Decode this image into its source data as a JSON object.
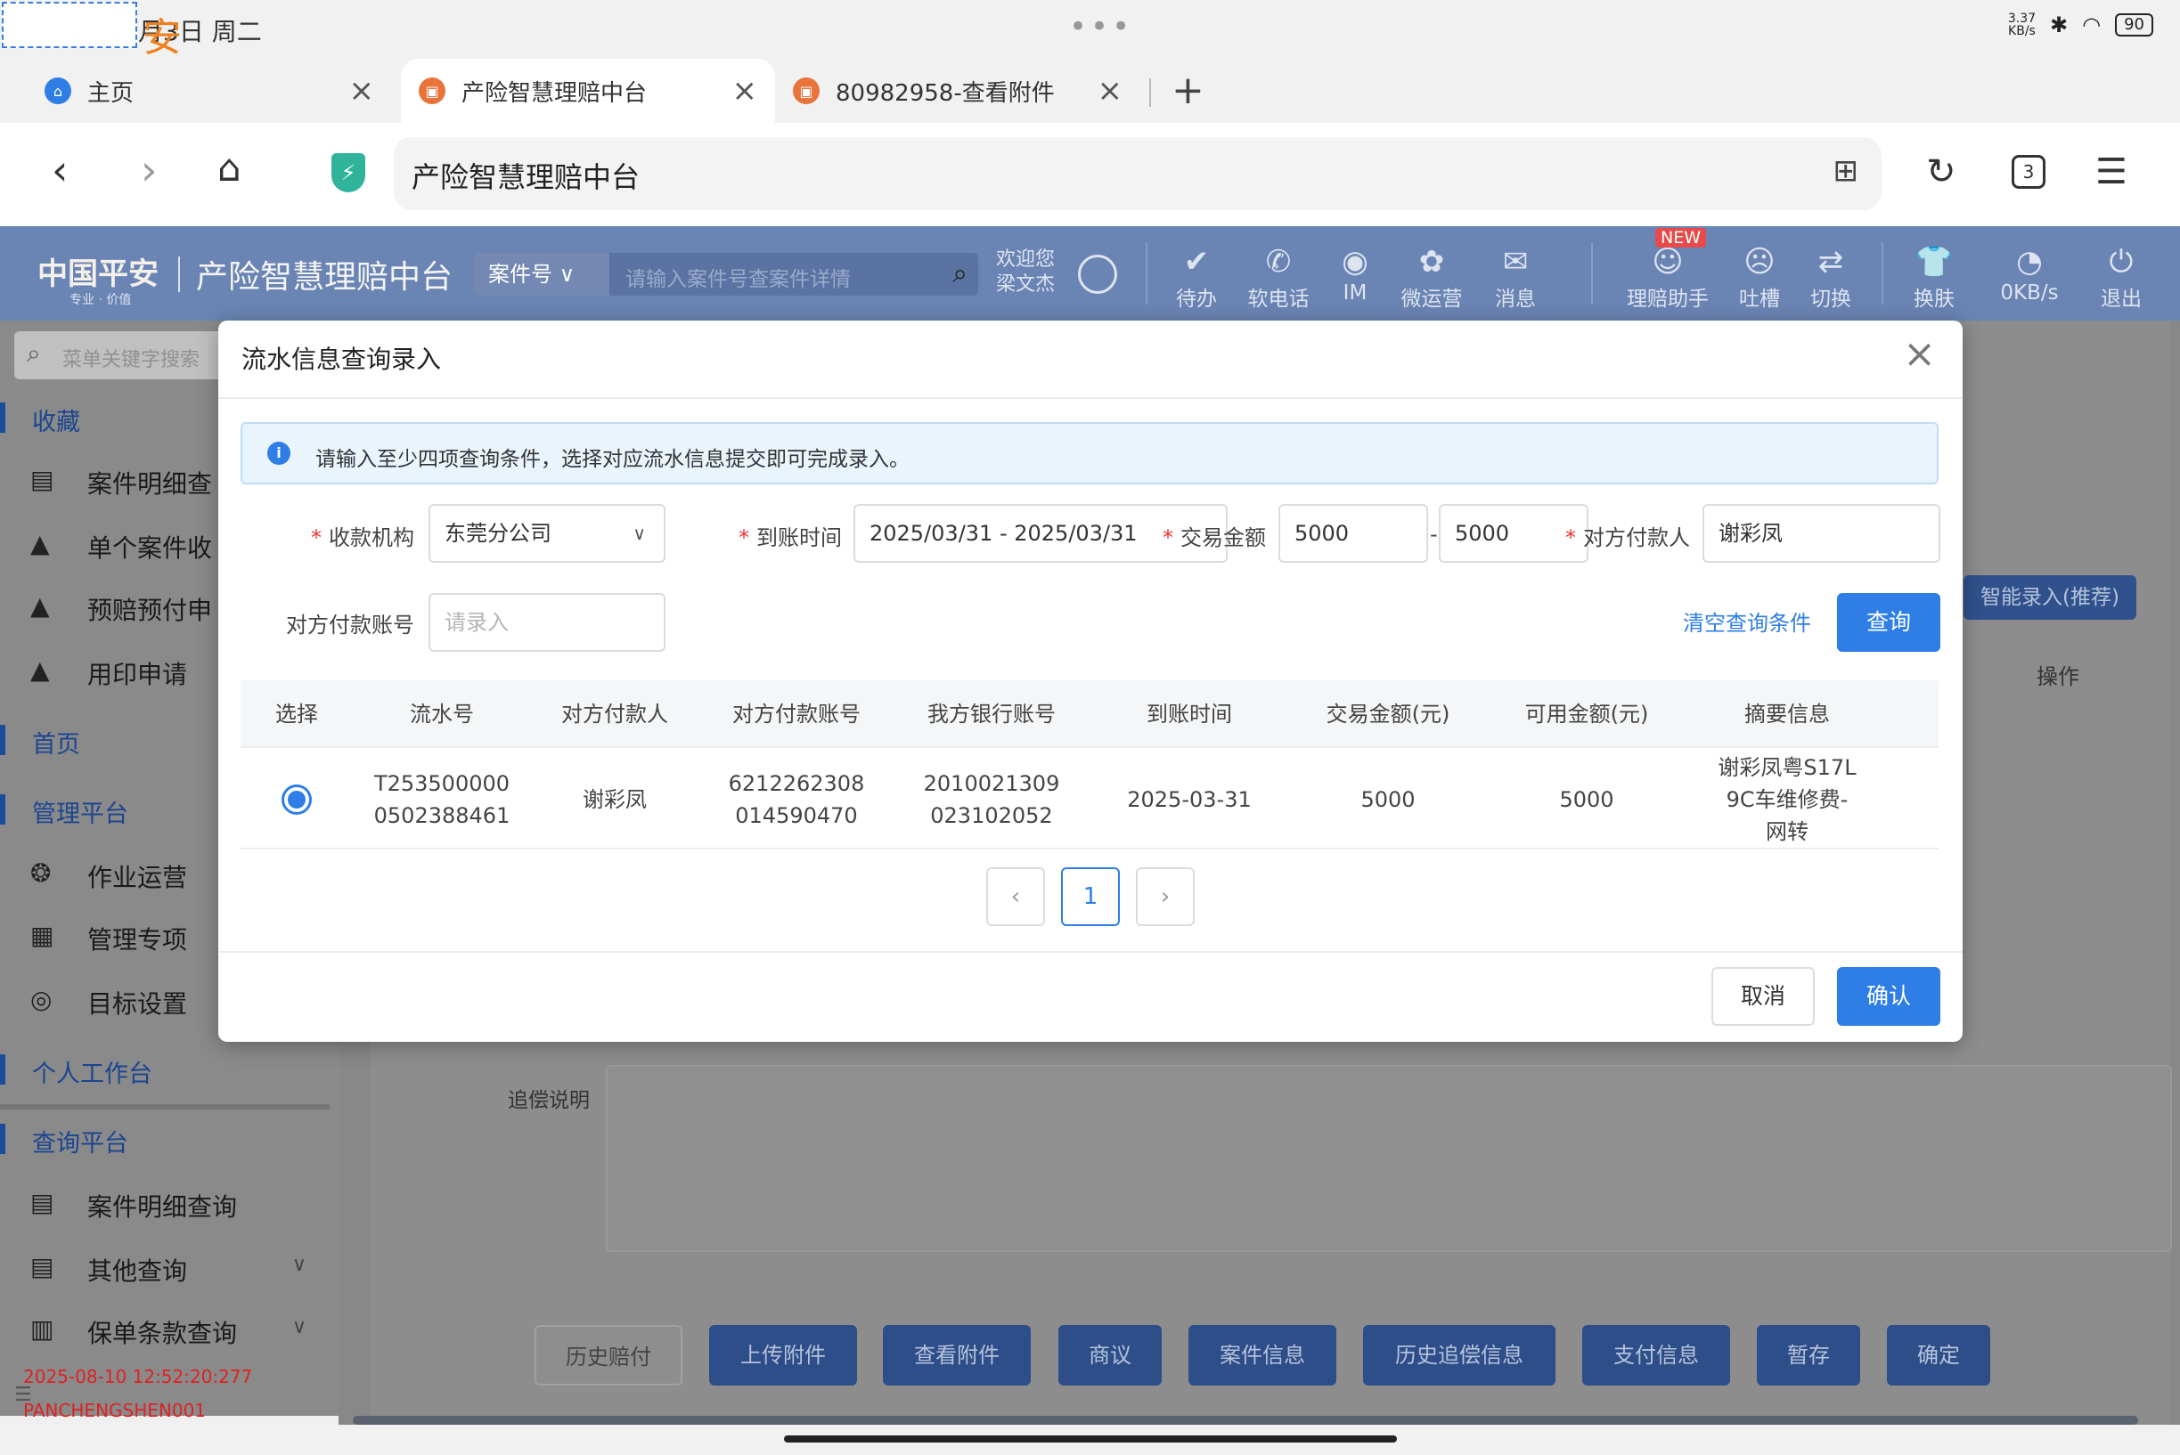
{
  "statusbar": {
    "orange_char": "安",
    "date": "月3日 周二",
    "dots": "•••",
    "speed_top": "3.37",
    "speed_unit": "KB/s",
    "battery": "90"
  },
  "browser": {
    "tabs": [
      {
        "label": "主页"
      },
      {
        "label": "产险智慧理赔中台"
      },
      {
        "label": "80982958-查看附件"
      }
    ],
    "url": "产险智慧理赔中台",
    "tab_count": "3"
  },
  "app_header": {
    "logo": "中国平安",
    "logo_sub": "专业 · 价值",
    "title": "产险智慧理赔中台",
    "search_type": "案件号",
    "search_placeholder": "请输入案件号查案件详情",
    "welcome_1": "欢迎您",
    "welcome_2": "梁文杰",
    "items": [
      {
        "label": "待办",
        "icon": "✔"
      },
      {
        "label": "软电话",
        "icon": "✆"
      },
      {
        "label": "IM",
        "icon": "◉"
      },
      {
        "label": "微运营",
        "icon": "✿"
      },
      {
        "label": "消息",
        "icon": "✉"
      },
      {
        "label": "理赔助手",
        "icon": "☺"
      },
      {
        "label": "吐槽",
        "icon": "☹"
      },
      {
        "label": "切换",
        "icon": "⇄"
      },
      {
        "label": "换肤",
        "icon": "👕"
      },
      {
        "label": "0KB/s",
        "icon": "◔"
      },
      {
        "label": "退出",
        "icon": "⏻"
      }
    ],
    "new_badge": "NEW"
  },
  "sidebar": {
    "search_placeholder": "菜单关键字搜索",
    "groups": {
      "favorites": "收藏",
      "home": "首页",
      "management": "管理平台",
      "personal": "个人工作台",
      "query": "查询平台"
    },
    "fav_items": [
      "案件明细查",
      "单个案件收",
      "预赔预付申",
      "用印申请"
    ],
    "mgmt_items": [
      "作业运营",
      "管理专项",
      "目标设置"
    ],
    "query_items": [
      "案件明细查询",
      "其他查询",
      "保单条款查询"
    ],
    "timestamp": "2025-08-10 12:52:20:277",
    "user_id": "PANCHENGSHEN001"
  },
  "background": {
    "smart_entry": "智能录入(推荐)",
    "operation": "操作",
    "repay_label": "追偿说明",
    "buttons": [
      "历史赔付",
      "上传附件",
      "查看附件",
      "商议",
      "案件信息",
      "历史追偿信息",
      "支付信息",
      "暂存",
      "确定"
    ]
  },
  "modal": {
    "title": "流水信息查询录入",
    "alert": "请输入至少四项查询条件，选择对应流水信息提交即可完成录入。",
    "fields": {
      "org_label": "收款机构",
      "org_value": "东莞分公司",
      "time_label": "到账时间",
      "time_value": "2025/03/31 - 2025/03/31",
      "amount_label": "交易金额",
      "amount_min": "5000",
      "amount_max": "5000",
      "amount_dash": "-",
      "payer_label": "对方付款人",
      "payer_value": "谢彩凤",
      "account_label": "对方付款账号",
      "account_placeholder": "请录入"
    },
    "clear_link": "清空查询条件",
    "query_button": "查询",
    "table": {
      "headers": [
        "选择",
        "流水号",
        "对方付款人",
        "对方付款账号",
        "我方银行账号",
        "到账时间",
        "交易金额(元)",
        "可用金额(元)",
        "摘要信息"
      ],
      "row": {
        "serial_1": "T253500000",
        "serial_2": "0502388461",
        "payer": "谢彩凤",
        "payer_acct_1": "6212262308",
        "payer_acct_2": "014590470",
        "our_acct_1": "2010021309",
        "our_acct_2": "023102052",
        "date": "2025-03-31",
        "amount": "5000",
        "available": "5000",
        "summary_1": "谢彩凤粤S17L",
        "summary_2": "9C车维修费-",
        "summary_3": "网转"
      }
    },
    "pagination": {
      "prev": "‹",
      "page": "1",
      "next": "›"
    },
    "cancel_button": "取消",
    "confirm_button": "确认"
  }
}
